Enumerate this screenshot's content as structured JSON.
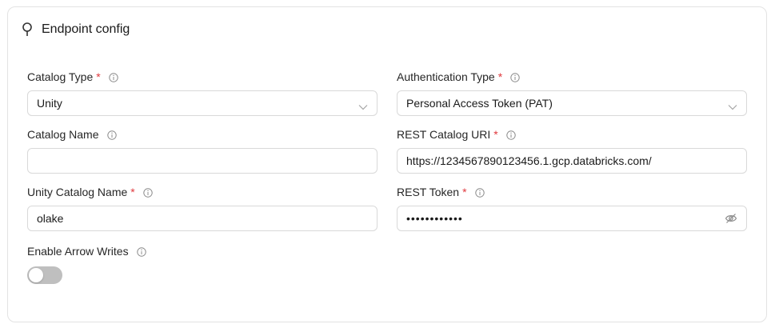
{
  "header": {
    "title": "Endpoint config",
    "icon": "pin-icon"
  },
  "fields": {
    "catalog_type": {
      "label": "Catalog Type",
      "required": "*",
      "value": "Unity"
    },
    "authentication_type": {
      "label": "Authentication Type",
      "required": "*",
      "value": "Personal Access Token (PAT)"
    },
    "catalog_name": {
      "label": "Catalog Name",
      "value": ""
    },
    "rest_catalog_uri": {
      "label": "REST Catalog URI",
      "required": "*",
      "value": "https://1234567890123456.1.gcp.databricks.com/"
    },
    "unity_catalog_name": {
      "label": "Unity Catalog Name",
      "required": "*",
      "value": "olake"
    },
    "rest_token": {
      "label": "REST Token",
      "required": "*",
      "value": "••••••••••••"
    },
    "enable_arrow_writes": {
      "label": "Enable Arrow Writes",
      "enabled": false
    }
  },
  "colors": {
    "required": "#e0393e",
    "border": "#d9d9d9",
    "toggle_off": "#bfbfbf"
  }
}
